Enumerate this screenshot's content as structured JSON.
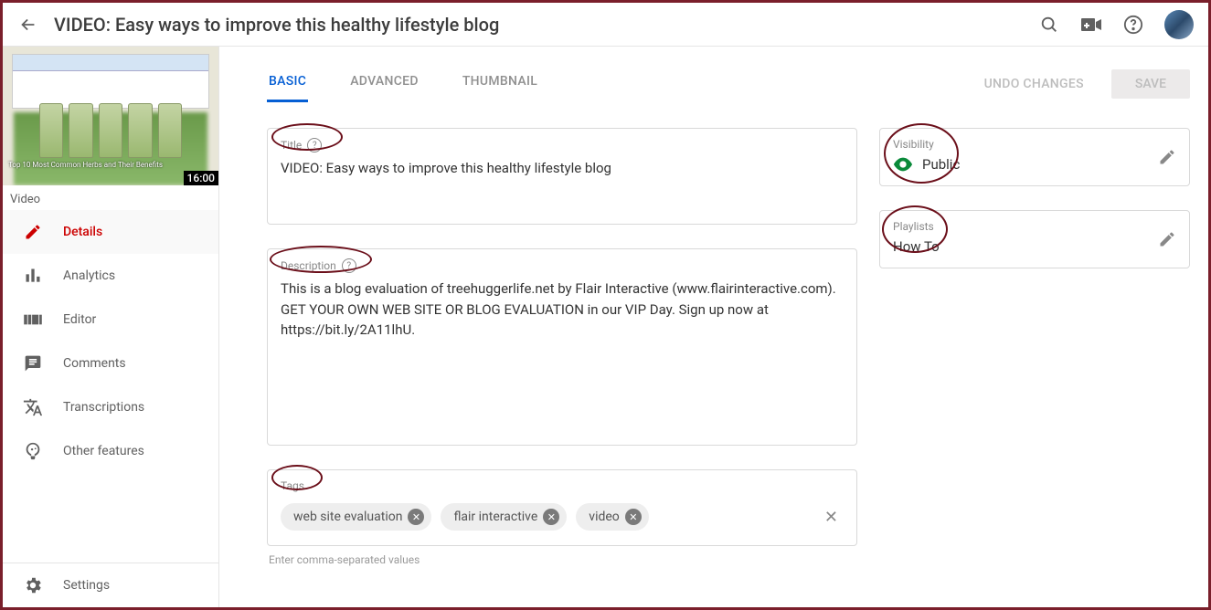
{
  "header": {
    "title": "VIDEO: Easy ways to improve this healthy lifestyle blog"
  },
  "thumbnail": {
    "duration": "16:00",
    "caption": "Top 10 Most Common Herbs and Their Benefits"
  },
  "sidebar": {
    "section_label": "Video",
    "items": [
      {
        "label": "Details",
        "active": true
      },
      {
        "label": "Analytics",
        "active": false
      },
      {
        "label": "Editor",
        "active": false
      },
      {
        "label": "Comments",
        "active": false
      },
      {
        "label": "Transcriptions",
        "active": false
      },
      {
        "label": "Other features",
        "active": false
      }
    ],
    "settings_label": "Settings"
  },
  "tabs": [
    {
      "label": "BASIC",
      "active": true
    },
    {
      "label": "ADVANCED",
      "active": false
    },
    {
      "label": "THUMBNAIL",
      "active": false
    }
  ],
  "buttons": {
    "undo": "UNDO CHANGES",
    "save": "SAVE"
  },
  "fields": {
    "title": {
      "label": "Title",
      "value": "VIDEO: Easy ways to improve this healthy lifestyle blog"
    },
    "description": {
      "label": "Description",
      "value": "This is a blog evaluation of treehuggerlife.net by Flair Interactive (www.flairinteractive.com). GET YOUR OWN WEB SITE OR BLOG EVALUATION in our VIP Day. Sign up now at https://bit.ly/2A11lhU."
    },
    "tags": {
      "label": "Tags",
      "helper": "Enter comma-separated values",
      "values": [
        "web site evaluation",
        "flair interactive",
        "video"
      ]
    }
  },
  "side": {
    "visibility": {
      "label": "Visibility",
      "value": "Public"
    },
    "playlists": {
      "label": "Playlists",
      "value": "How To"
    }
  }
}
